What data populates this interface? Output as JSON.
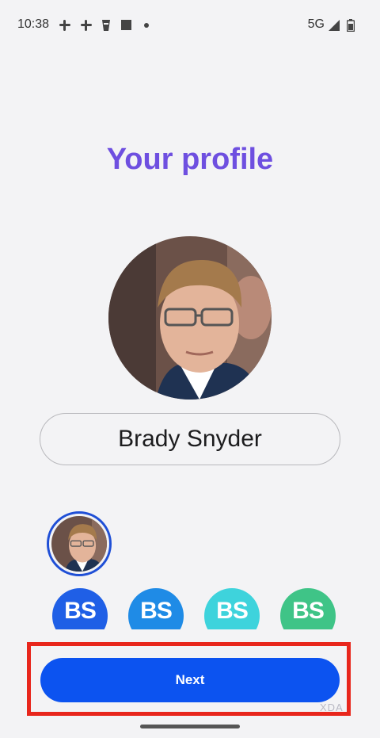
{
  "status_bar": {
    "time": "10:38",
    "network": "5G",
    "icons": [
      "slack-icon",
      "slack-icon",
      "cup-icon",
      "square-icon",
      "dot-icon",
      "signal-icon",
      "battery-icon"
    ]
  },
  "page": {
    "title": "Your profile",
    "title_color": "#6e4fe0"
  },
  "profile": {
    "name": "Brady Snyder"
  },
  "monograms": [
    {
      "text": "BS",
      "color": "#1f5fe6"
    },
    {
      "text": "BS",
      "color": "#1f8be6"
    },
    {
      "text": "BS",
      "color": "#3ed3dc"
    },
    {
      "text": "BS",
      "color": "#3fc487"
    }
  ],
  "actions": {
    "next_label": "Next",
    "next_color": "#0c53f0"
  },
  "watermark": "XDA"
}
